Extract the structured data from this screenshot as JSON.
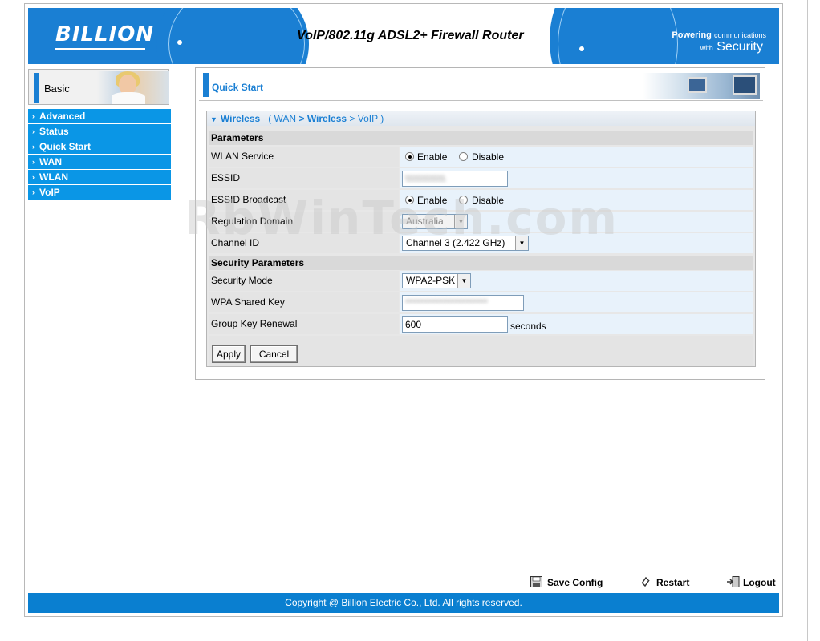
{
  "header": {
    "logo": "BILLION",
    "title": "VoIP/802.11g ADSL2+ Firewall Router",
    "slogan_line1_bold": "Powering",
    "slogan_line1_small": "communications",
    "slogan_line2_small": "with",
    "slogan_line2_big": "Security"
  },
  "sidebar": {
    "basic_label": "Basic",
    "items": [
      {
        "label": "Advanced"
      },
      {
        "label": "Status"
      },
      {
        "label": "Quick Start"
      },
      {
        "label": "WAN"
      },
      {
        "label": "WLAN"
      },
      {
        "label": "VoIP"
      }
    ]
  },
  "main": {
    "page_title": "Quick Start",
    "breadcrumb": {
      "current": "Wireless",
      "open_paren": "(",
      "step1": "WAN",
      "sep1": ">",
      "step2": "Wireless",
      "sep2": ">",
      "step3": "VoIP",
      "close_paren": ")"
    },
    "parameters_title": "Parameters",
    "wlan_service": {
      "label": "WLAN Service",
      "enable": "Enable",
      "disable": "Disable",
      "selected": "Enable"
    },
    "essid": {
      "label": "ESSID",
      "value": "\\\\\\\\\\\\\\\\\\\\\\\\\\\\\\"
    },
    "essid_broadcast": {
      "label": "ESSID Broadcast",
      "enable": "Enable",
      "disable": "Disable",
      "selected": "Enable"
    },
    "regulation_domain": {
      "label": "Regulation Domain",
      "value": "Australia"
    },
    "channel_id": {
      "label": "Channel ID",
      "value": "Channel 3 (2.422 GHz)"
    },
    "security_title": "Security Parameters",
    "security_mode": {
      "label": "Security Mode",
      "value": "WPA2-PSK"
    },
    "wpa_key": {
      "label": "WPA Shared Key",
      "value": "**********************"
    },
    "group_key": {
      "label": "Group Key Renewal",
      "value": "600",
      "unit": "seconds"
    },
    "apply_label": "Apply",
    "cancel_label": "Cancel"
  },
  "watermark": "RbWinTech.com",
  "actions": {
    "save": "Save Config",
    "restart": "Restart",
    "logout": "Logout"
  },
  "footer": {
    "copyright": "Copyright @ Billion Electric Co., Ltd. All rights reserved."
  },
  "colors": {
    "brand_blue": "#1a7fd3",
    "menu_blue": "#0a96e6",
    "footer_blue": "#0a7fd0"
  }
}
